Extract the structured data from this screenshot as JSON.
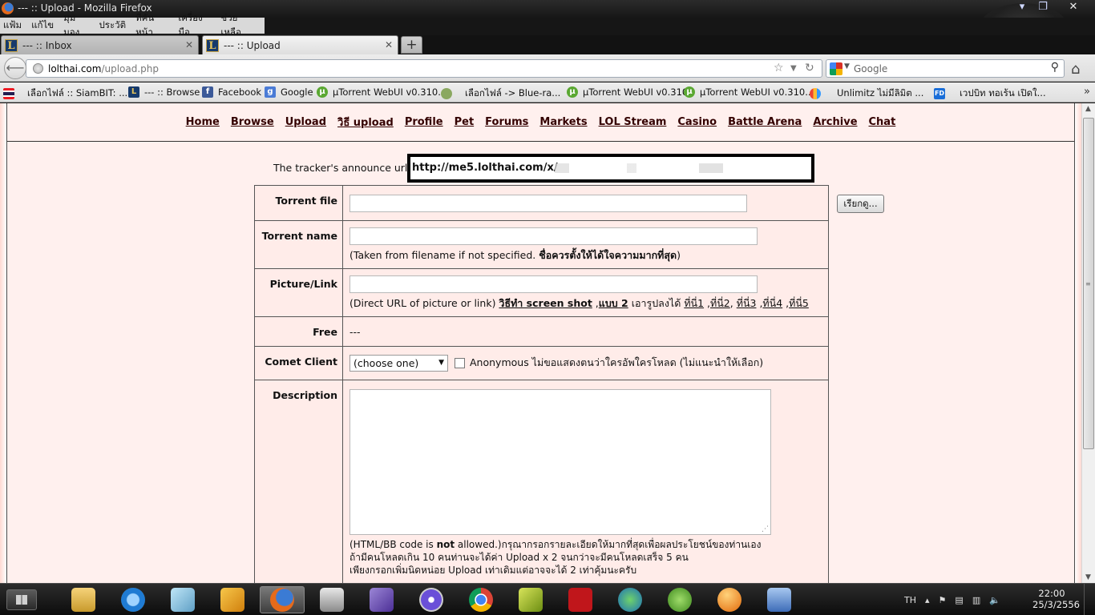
{
  "window": {
    "title": "--- :: Upload - Mozilla Firefox",
    "menu": [
      "แฟ้ม",
      "แก้ไข",
      "มุมมอง",
      "ประวัติ",
      "ที่คั่นหน้า",
      "เครื่องมือ",
      "ช่วยเหลือ"
    ]
  },
  "tabs": [
    {
      "label": "--- :: Inbox",
      "active": false
    },
    {
      "label": "--- :: Upload",
      "active": true
    }
  ],
  "nav": {
    "url_host": "lolthai.com",
    "url_path": "/upload.php",
    "search_placeholder": "Google"
  },
  "bookmarks": [
    {
      "label": "เลือกไฟล์ :: SiamBIT: ...",
      "icon": "thai-flag-icon"
    },
    {
      "label": "--- :: Browse",
      "icon": "lol-icon"
    },
    {
      "label": "Facebook",
      "icon": "facebook-icon"
    },
    {
      "label": "Google",
      "icon": "google-icon"
    },
    {
      "label": "µTorrent WebUI v0.310...",
      "icon": "utorrent-icon"
    },
    {
      "label": "เลือกไฟล์ -> Blue-ra...",
      "icon": "frog-icon"
    },
    {
      "label": "µTorrent WebUI v0.310",
      "icon": "utorrent-icon"
    },
    {
      "label": "µTorrent WebUI v0.310...",
      "icon": "utorrent-icon"
    },
    {
      "label": "Unlimitz ไม่มีลิมิต ...",
      "icon": "heart-icon"
    },
    {
      "label": "เวปบิท ทอเร้น เปิดใ...",
      "icon": "fd-icon"
    }
  ],
  "site_nav": [
    "Home",
    "Browse",
    "Upload",
    "วิธี upload",
    "Profile",
    "Pet",
    "Forums",
    "Markets",
    "LOL Stream",
    "Casino",
    "Battle Arena",
    "Archive",
    "Chat"
  ],
  "announce": {
    "prefix": "The tracker's announce url is",
    "url": "http://me5.lolthai.com/x/"
  },
  "form": {
    "torrent_file_label": "Torrent file",
    "browse_button": "เรียกดู...",
    "torrent_name_label": "Torrent name",
    "torrent_name_hint_a": "(Taken from filename if not specified. ",
    "torrent_name_hint_b": "ชื่อควรตั้งให้ได้ใจความมากที่สุด",
    "torrent_name_hint_c": ")",
    "picture_label": "Picture/Link",
    "picture_hint_a": "(Direct URL of picture or link) ",
    "picture_hint_howto": "วิธีทำ screen shot",
    "picture_hint_sep1": " ,",
    "picture_hint_style2": "แบบ 2",
    "picture_hint_b": " เอารูปลงได้ ",
    "picture_links": [
      "ที่นี่1",
      "ที่นี่2",
      "ที่นี่3",
      "ที่นี่4",
      "ที่นี่5"
    ],
    "free_label": "Free",
    "free_value": "---",
    "comet_label": "Comet Client",
    "comet_select": "(choose one)",
    "anonymous_label": "Anonymous ไม่ขอแสดงตนว่าใครอัพใครโหลด (ไม่แนะนำให้เลือก)",
    "description_label": "Description",
    "desc_note_a": "(HTML/BB code is ",
    "desc_note_not": "not",
    "desc_note_b": " allowed.)กรุณากรอกรายละเอียดให้มากที่สุดเพื่อผลประโยชน์ของท่านเอง",
    "desc_note_line2": "ถ้ามีคนโหลดเกิน 10 คนท่านจะได้ค่า Upload x 2 จนกว่าจะมีคนโหลดเสร็จ 5 คน",
    "desc_note_line3": "เพียงกรอกเพิ่มนิดหน่อย Upload เท่าเดิมแต่อาจจะได้ 2 เท่าคุ้มนะครับ"
  },
  "taskbar": {
    "lang": "TH",
    "time": "22:00",
    "date": "25/3/2556"
  }
}
